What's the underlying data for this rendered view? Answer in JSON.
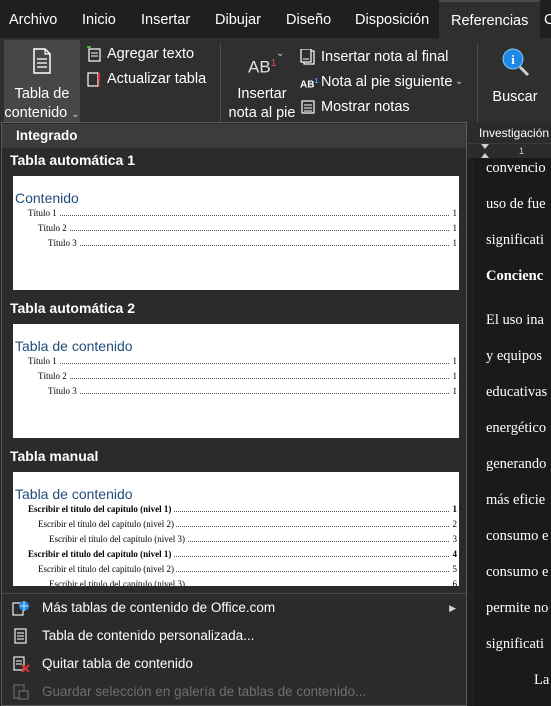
{
  "tabs": [
    "Archivo",
    "Inicio",
    "Insertar",
    "Dibujar",
    "Diseño",
    "Disposición",
    "Referencias",
    "C"
  ],
  "active_tab": "Referencias",
  "ribbon": {
    "toc_button": [
      "Tabla de",
      "contenido"
    ],
    "add_text": "Agregar texto",
    "update_table": "Actualizar tabla",
    "insert_footnote": [
      "Insertar",
      "nota al pie"
    ],
    "insert_endnote": "Insertar nota al final",
    "next_footnote": "Nota al pie siguiente",
    "show_notes": "Mostrar notas",
    "search": "Buscar",
    "research_pane": "Investigación"
  },
  "dropdown": {
    "header": "Integrado",
    "sections": [
      {
        "title": "Tabla automática 1",
        "preview_title": "Contenido",
        "lines": [
          {
            "text": "Título 1",
            "page": "1",
            "level": 1,
            "bold": false
          },
          {
            "text": "Título 2",
            "page": "1",
            "level": 2,
            "bold": false
          },
          {
            "text": "Título 3",
            "page": "1",
            "level": 3,
            "bold": false
          }
        ]
      },
      {
        "title": "Tabla automática 2",
        "preview_title": "Tabla de contenido",
        "lines": [
          {
            "text": "Título 1",
            "page": "1",
            "level": 1,
            "bold": false
          },
          {
            "text": "Título 2",
            "page": "1",
            "level": 2,
            "bold": false
          },
          {
            "text": "Título 3",
            "page": "1",
            "level": 3,
            "bold": false
          }
        ]
      },
      {
        "title": "Tabla manual",
        "preview_title": "Tabla de contenido",
        "lines": [
          {
            "text": "Escribir el título del capítulo (nivel 1)",
            "page": "1",
            "level": 1,
            "bold": true
          },
          {
            "text": "Escribir el título del capítulo (nivel 2)",
            "page": "2",
            "level": 2,
            "bold": false
          },
          {
            "text": "Escribir el título del capítulo (nivel 3)",
            "page": "3",
            "level": 3,
            "bold": false
          },
          {
            "text": "Escribir el título del capítulo (nivel 1)",
            "page": "4",
            "level": 1,
            "bold": true
          },
          {
            "text": "Escribir el título del capítulo (nivel 2)",
            "page": "5",
            "level": 2,
            "bold": false
          },
          {
            "text": "Escribir el título del capítulo (nivel 3)",
            "page": "6",
            "level": 3,
            "bold": false
          }
        ]
      }
    ],
    "menu": [
      {
        "label": "Más tablas de contenido de Office.com",
        "icon": "office-globe-icon",
        "submenu": true,
        "disabled": false
      },
      {
        "label": "Tabla de contenido personalizada...",
        "icon": "custom-toc-icon",
        "submenu": false,
        "disabled": false
      },
      {
        "label": "Quitar tabla de contenido",
        "icon": "remove-toc-icon",
        "submenu": false,
        "disabled": false
      },
      {
        "label": "Guardar selección en galería de tablas de contenido...",
        "icon": "save-gallery-icon",
        "submenu": false,
        "disabled": true
      }
    ]
  },
  "document": {
    "ruler_mark": "1",
    "lines": [
      {
        "text": "convencio",
        "bold": false
      },
      {
        "text": "uso de fue",
        "bold": false
      },
      {
        "text": "significati",
        "bold": false
      },
      {
        "text": "Concienc",
        "bold": true
      },
      {
        "text": "El uso ina",
        "bold": false
      },
      {
        "text": "y equipos",
        "bold": false
      },
      {
        "text": "educativas",
        "bold": false
      },
      {
        "text": "energético",
        "bold": false
      },
      {
        "text": "generando",
        "bold": false
      },
      {
        "text": "más eficie",
        "bold": false
      },
      {
        "text": "consumo e",
        "bold": false
      },
      {
        "text": "consumo e",
        "bold": false
      },
      {
        "text": "permite no",
        "bold": false
      },
      {
        "text": "significati",
        "bold": false
      },
      {
        "text": "La",
        "bold": false
      }
    ]
  },
  "colors": {
    "background": "#1f1f1f",
    "ribbon": "#2f2f2f",
    "preview_heading": "#1f4e79"
  }
}
